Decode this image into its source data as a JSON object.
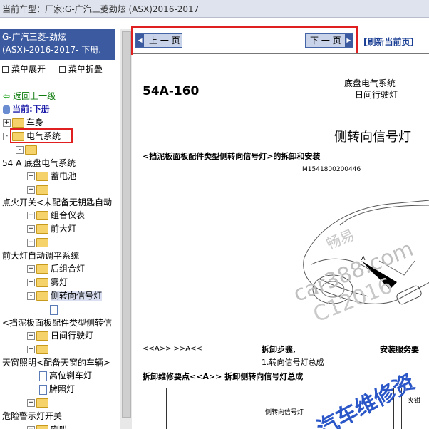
{
  "top": {
    "label": "当前车型：",
    "value": "厂家:G-广汽三菱劲炫 (ASX)2016-2017"
  },
  "sidebar": {
    "title_line1": "G-广汽三菱-劲炫",
    "title_line2": "(ASX)-2016-2017- 下册.",
    "expand_menu": "菜单展开",
    "collapse_menu": "菜单折叠",
    "back_link": "返回上一级",
    "current_label": "当前:下册",
    "tree": [
      {
        "label": "车身",
        "kind": "folder",
        "toggle": "+"
      },
      {
        "label": "电气系统",
        "kind": "folder",
        "toggle": "-"
      },
      {
        "label": "",
        "kind": "folder",
        "toggle": "-"
      },
      {
        "label": "54 A 底盘电气系统",
        "kind": "text",
        "toggle": ""
      },
      {
        "label": "蓄电池",
        "kind": "folder",
        "toggle": "+"
      },
      {
        "label": "",
        "kind": "folder",
        "toggle": "+"
      },
      {
        "label": "点火开关<未配备无钥匙自动",
        "kind": "text",
        "toggle": ""
      },
      {
        "label": "组合仪表",
        "kind": "folder",
        "toggle": "+"
      },
      {
        "label": "前大灯",
        "kind": "folder",
        "toggle": "+"
      },
      {
        "label": "",
        "kind": "folder",
        "toggle": "+"
      },
      {
        "label": "前大灯自动调平系统",
        "kind": "text",
        "toggle": ""
      },
      {
        "label": "后组合灯",
        "kind": "folder",
        "toggle": "+"
      },
      {
        "label": "雾灯",
        "kind": "folder",
        "toggle": "+"
      },
      {
        "label": "侧转向信号灯",
        "kind": "folder",
        "toggle": "-"
      },
      {
        "label": "",
        "kind": "doc",
        "toggle": ""
      },
      {
        "label": "<挡泥板面板配件类型侧转信",
        "kind": "text",
        "toggle": ""
      },
      {
        "label": "日间行驶灯",
        "kind": "folder",
        "toggle": "+"
      },
      {
        "label": "",
        "kind": "folder",
        "toggle": "+"
      },
      {
        "label": "天窗照明<配备天窗的车辆>",
        "kind": "text",
        "toggle": ""
      },
      {
        "label": "高位刹车灯",
        "kind": "doc",
        "toggle": ""
      },
      {
        "label": "牌照灯",
        "kind": "doc",
        "toggle": ""
      },
      {
        "label": "",
        "kind": "folder",
        "toggle": "+"
      },
      {
        "label": "危险警示灯开关",
        "kind": "text",
        "toggle": ""
      },
      {
        "label": "喇叭",
        "kind": "folder",
        "toggle": "+"
      }
    ]
  },
  "nav": {
    "prev": "上 一 页",
    "next": "下 一 页",
    "refresh": "[刷新当前页]"
  },
  "doc": {
    "page_code": "54A-160",
    "section": "底盘电气系统",
    "subsection": "日间行驶灯",
    "heading": "侧转向信号灯",
    "subheading": "<挡泥板面板配件类型侧转向信号灯>的拆卸和安装",
    "part_code": "M1541800200446",
    "callout": "A",
    "ref": "<<A>> >>A<<",
    "steps_title": "拆卸步骤,",
    "step1": "1.转向信号灯总成",
    "install_title": "安装服务要",
    "service_point": "拆卸维修要点<<A>> 拆卸侧转向信号灯总成",
    "diagram_label": "侧转向信号灯",
    "diagram_label2": "夹钳",
    "watermarks": [
      "畅易",
      "car388.com",
      "C12016",
      "汽车维修资"
    ]
  }
}
